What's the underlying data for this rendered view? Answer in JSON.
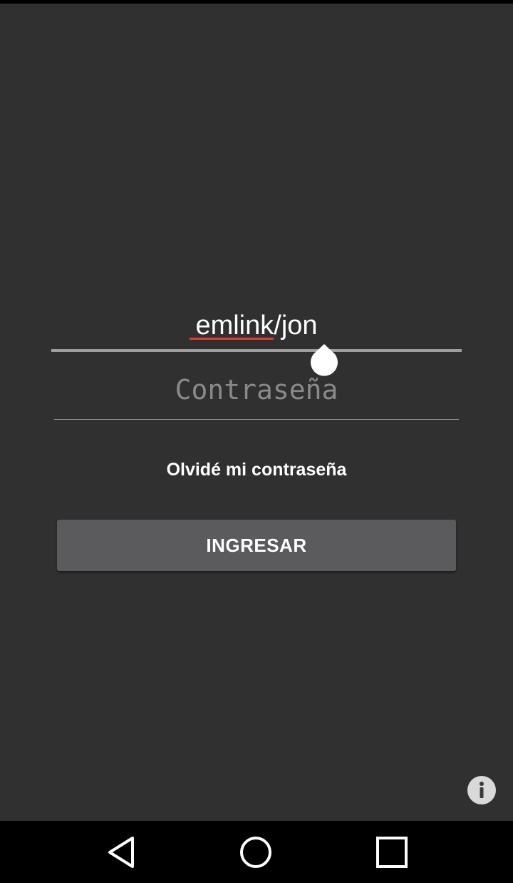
{
  "login": {
    "username_value": "emlink/jon",
    "password_placeholder": "Contraseña",
    "forgot_password_label": "Olvidé mi contraseña",
    "submit_label": "INGRESAR"
  },
  "icons": {
    "info": "info-icon",
    "back": "back-triangle-icon",
    "home": "home-circle-icon",
    "recents": "recents-square-icon",
    "cursor": "text-cursor-handle-icon"
  },
  "colors": {
    "background": "#303030",
    "button": "#5b5b5d",
    "text": "#ffffff",
    "placeholder": "#8a8a8a",
    "spellcheck": "#e53935",
    "nav_bar": "#000000"
  }
}
